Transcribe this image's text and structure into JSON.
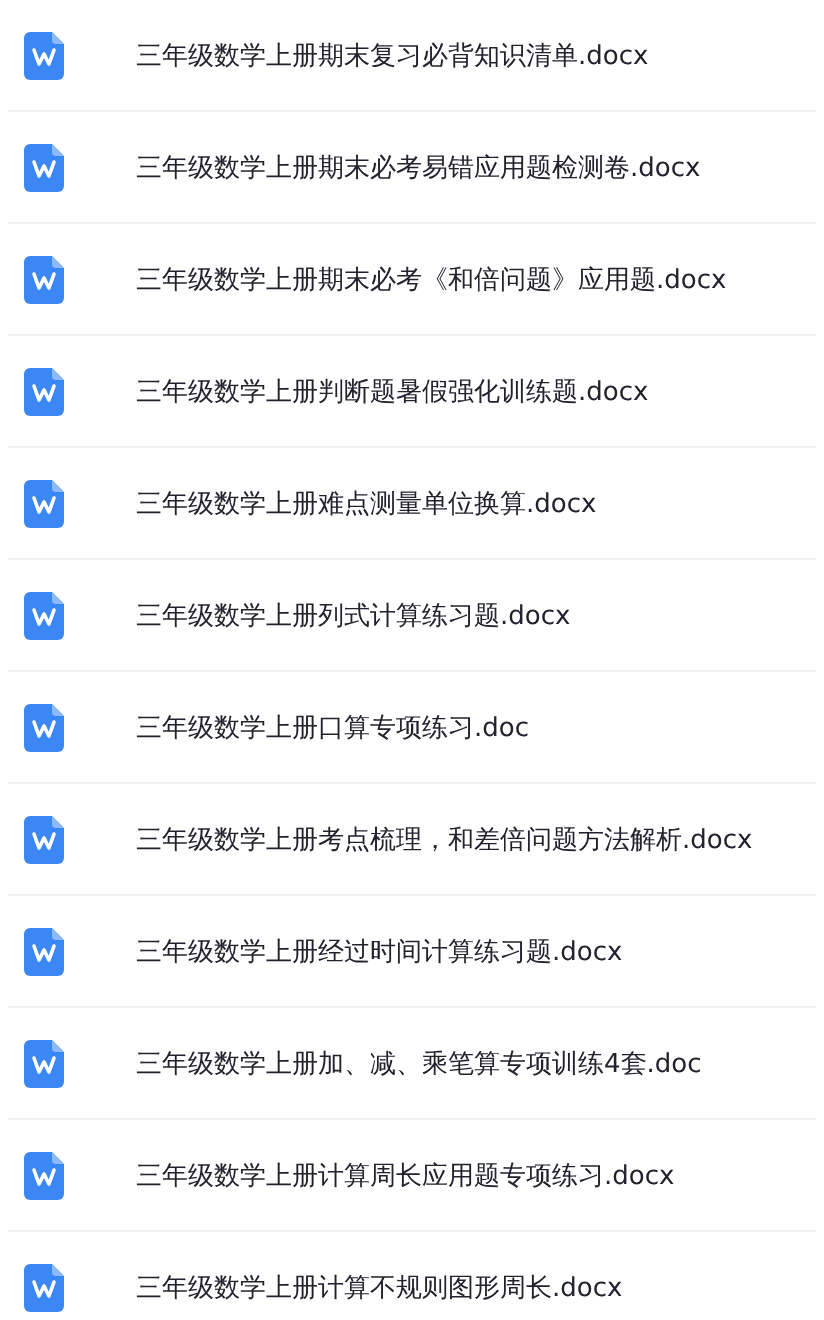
{
  "files": [
    {
      "name": "三年级数学上册期末复习必背知识清单.docx"
    },
    {
      "name": "三年级数学上册期末必考易错应用题检测卷.docx"
    },
    {
      "name": "三年级数学上册期末必考《和倍问题》应用题.docx"
    },
    {
      "name": "三年级数学上册判断题暑假强化训练题.docx"
    },
    {
      "name": "三年级数学上册难点测量单位换算.docx"
    },
    {
      "name": "三年级数学上册列式计算练习题.docx"
    },
    {
      "name": "三年级数学上册口算专项练习.doc"
    },
    {
      "name": "三年级数学上册考点梳理，和差倍问题方法解析.docx"
    },
    {
      "name": "三年级数学上册经过时间计算练习题.docx"
    },
    {
      "name": "三年级数学上册加、减、乘笔算专项训练4套.doc"
    },
    {
      "name": "三年级数学上册计算周长应用题专项练习.docx"
    },
    {
      "name": "三年级数学上册计算不规则图形周长.docx"
    }
  ]
}
